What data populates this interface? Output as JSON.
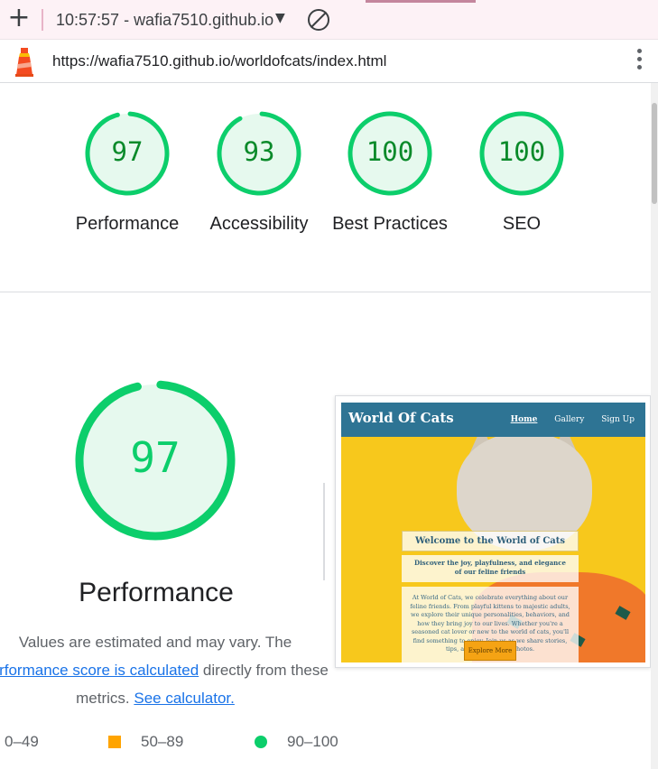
{
  "browser": {
    "new_tab_symbol": "+",
    "tab_title": "10:57:57 - wafia7510.github.io",
    "caret": "▼",
    "url": "https://wafia7510.github.io/worldofcats/index.html"
  },
  "summary_gauges": [
    {
      "score": "97",
      "label": "Performance",
      "fraction": 0.97
    },
    {
      "score": "93",
      "label": "Accessibility",
      "fraction": 0.93
    },
    {
      "score": "100",
      "label": "Best Practices",
      "fraction": 1.0
    },
    {
      "score": "100",
      "label": "SEO",
      "fraction": 1.0
    }
  ],
  "performance": {
    "score": "97",
    "fraction": 0.97,
    "title": "Performance",
    "desc_line1": "Values are estimated and may vary. The",
    "desc_link1": "performance score is calculated",
    "desc_mid": "directly from these",
    "desc_line3": "metrics.",
    "desc_link2": "See calculator."
  },
  "legend": {
    "fail": "0–49",
    "average": "50–89",
    "pass": "90–100"
  },
  "site_preview": {
    "brand": "World Of Cats",
    "nav": [
      "Home",
      "Gallery",
      "Sign Up"
    ],
    "hero_title": "Welcome to the World of Cats",
    "hero_subtitle": "Discover the joy, playfulness, and elegance of our feline friends",
    "hero_body": "At World of Cats, we celebrate everything about our feline friends. From playful kittens to majestic adults, we explore their unique personalities, behaviors, and how they bring joy to our lives. Whether you're a seasoned cat lover or new to the world of cats, you'll find something to enjoy. Join us as we share stories, tips, and adorable cat photos.",
    "cta": "Explore More"
  },
  "colors": {
    "pass": "#0cce6b",
    "pass_text": "#0a8a2a",
    "pass_fill": "#e6f9ee",
    "average": "#ffa400",
    "link": "#1a73e8",
    "site_nav": "#2e7494"
  }
}
